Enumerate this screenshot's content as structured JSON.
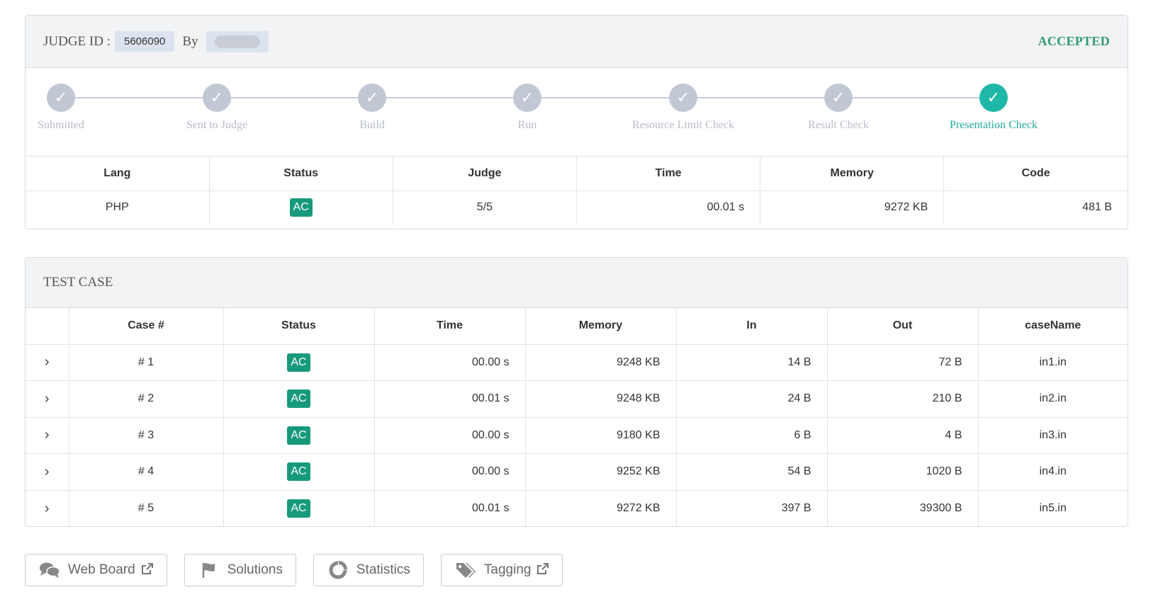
{
  "judge": {
    "label": "JUDGE ID :",
    "id": "5606090",
    "by_label": "By",
    "verdict": "ACCEPTED"
  },
  "steps": [
    {
      "label": "Submitted",
      "active": false
    },
    {
      "label": "Sent to Judge",
      "active": false
    },
    {
      "label": "Build",
      "active": false
    },
    {
      "label": "Run",
      "active": false
    },
    {
      "label": "Resource Limit Check",
      "active": false
    },
    {
      "label": "Result Check",
      "active": false
    },
    {
      "label": "Presentation Check",
      "active": true
    }
  ],
  "summary": {
    "headers": [
      "Lang",
      "Status",
      "Judge",
      "Time",
      "Memory",
      "Code"
    ],
    "row": {
      "lang": "PHP",
      "status": "AC",
      "judge": "5/5",
      "time": "00.01 s",
      "memory": "9272 KB",
      "code": "481 B"
    }
  },
  "testcase": {
    "title": "TEST CASE",
    "headers": [
      "",
      "Case #",
      "Status",
      "Time",
      "Memory",
      "In",
      "Out",
      "caseName"
    ],
    "rows": [
      {
        "case": "# 1",
        "status": "AC",
        "time": "00.00 s",
        "memory": "9248 KB",
        "in": "14 B",
        "out": "72 B",
        "name": "in1.in"
      },
      {
        "case": "# 2",
        "status": "AC",
        "time": "00.01 s",
        "memory": "9248 KB",
        "in": "24 B",
        "out": "210 B",
        "name": "in2.in"
      },
      {
        "case": "# 3",
        "status": "AC",
        "time": "00.00 s",
        "memory": "9180 KB",
        "in": "6 B",
        "out": "4 B",
        "name": "in3.in"
      },
      {
        "case": "# 4",
        "status": "AC",
        "time": "00.00 s",
        "memory": "9252 KB",
        "in": "54 B",
        "out": "1020 B",
        "name": "in4.in"
      },
      {
        "case": "# 5",
        "status": "AC",
        "time": "00.01 s",
        "memory": "9272 KB",
        "in": "397 B",
        "out": "39300 B",
        "name": "in5.in"
      }
    ]
  },
  "buttons": {
    "webboard": "Web Board",
    "solutions": "Solutions",
    "statistics": "Statistics",
    "tagging": "Tagging"
  },
  "colors": {
    "accepted": "#2e9a73",
    "ac_badge": "#179a7c",
    "step_active": "#1fb7a8",
    "step_inactive": "#c2c8d3"
  }
}
